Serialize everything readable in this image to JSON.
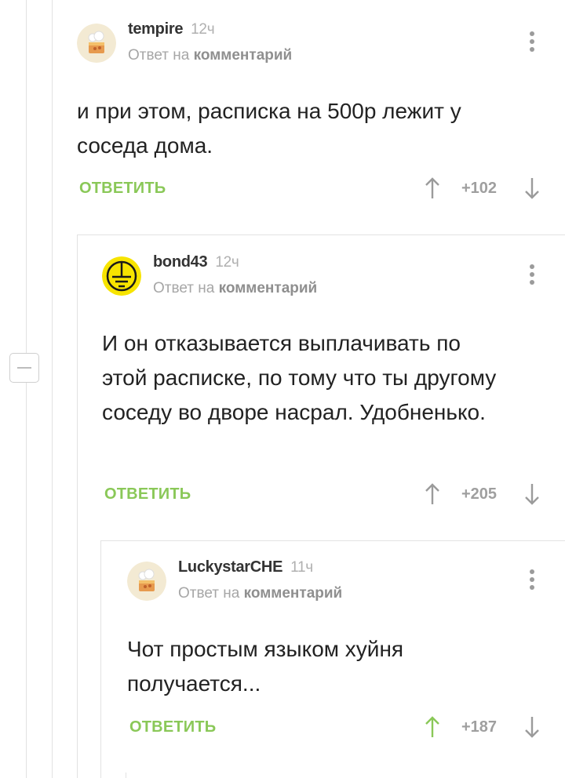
{
  "comments": [
    {
      "author": "tempire",
      "time": "12ч",
      "reply_prefix": "Ответ на",
      "reply_link": "комментарий",
      "text": "и при этом, расписка на 500р лежит у соседа дома.",
      "reply_label": "ОТВЕТИТЬ",
      "score": "+102",
      "avatar": "cake-icon"
    },
    {
      "author": "bond43",
      "time": "12ч",
      "reply_prefix": "Ответ на",
      "reply_link": "комментарий",
      "text": "И он отказывается выплачивать по этой расписке, по тому что ты другому соседу во дворе насрал. Удобненько.",
      "reply_label": "ОТВЕТИТЬ",
      "score": "+205",
      "avatar": "ground-symbol-icon"
    },
    {
      "author": "LuckystarCHE",
      "time": "11ч",
      "reply_prefix": "Ответ на",
      "reply_link": "комментарий",
      "text": "Чот простым языком хуйня получается...",
      "reply_label": "ОТВЕТИТЬ",
      "score": "+187",
      "avatar": "cake-icon",
      "upvoted": true
    }
  ],
  "colors": {
    "accent_green": "#8ac858",
    "upvote_active": "#8ac858",
    "arrow_default": "#9b9b9b",
    "thread_line": "#e2e2e2"
  }
}
